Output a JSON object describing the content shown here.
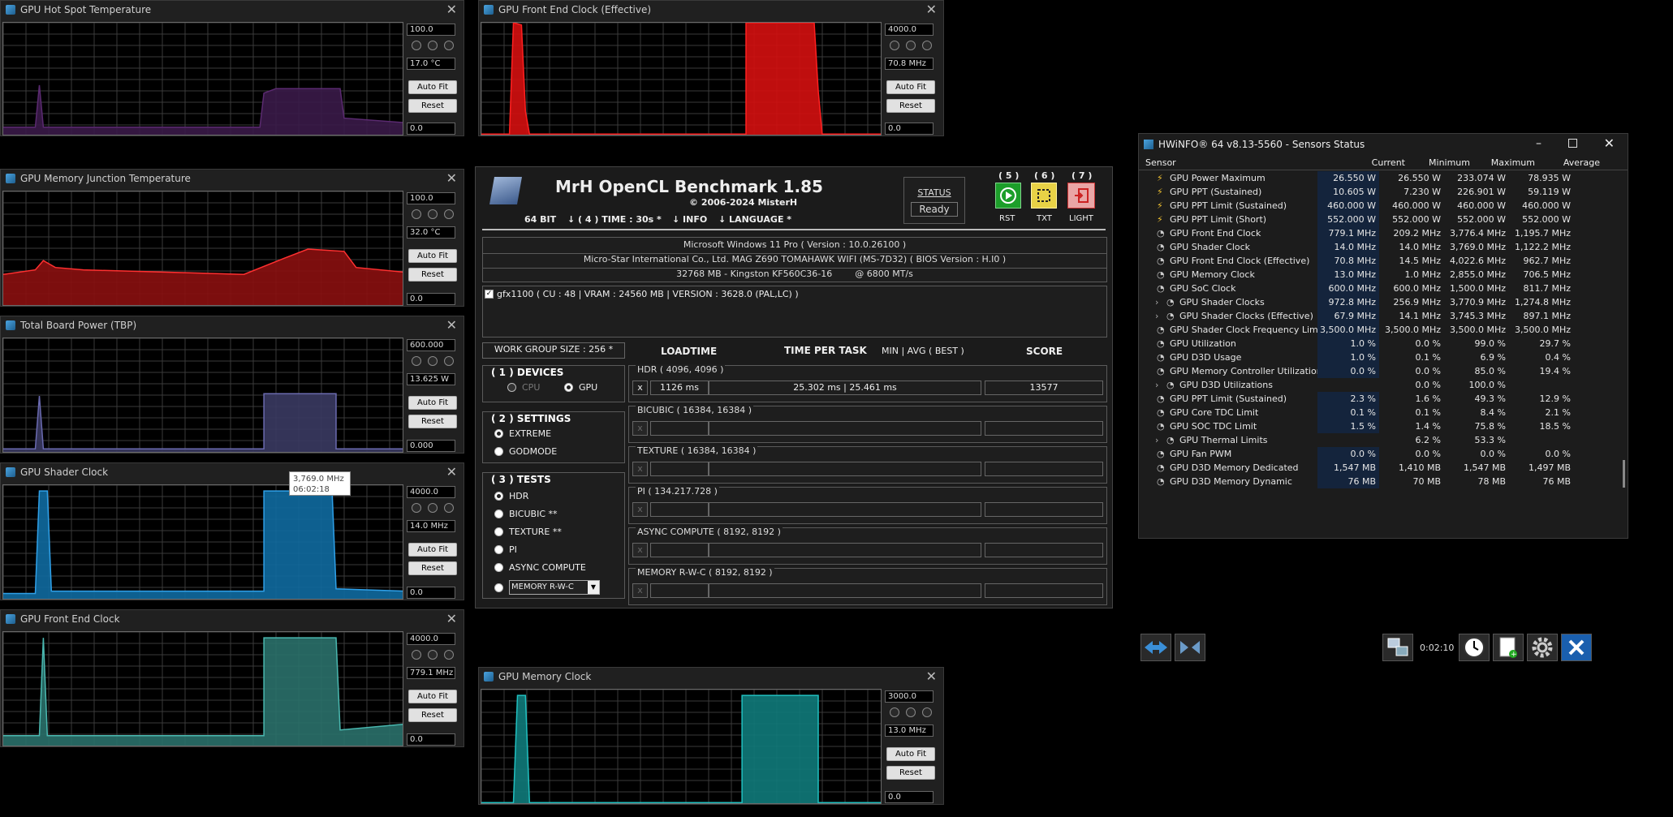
{
  "graph_windows": [
    {
      "id": "hotspot",
      "title": "GPU Hot Spot Temperature",
      "max": "100.0",
      "current": "17.0 °C",
      "min": "0.0",
      "color": "#5a2a70",
      "fill": "#3a1a48"
    },
    {
      "id": "fe-eff",
      "title": "GPU Front End Clock (Effective)",
      "max": "4000.0",
      "current": "70.8 MHz",
      "min": "0.0",
      "color": "#ff2020",
      "fill": "#d41010"
    },
    {
      "id": "memjunc",
      "title": "GPU Memory Junction Temperature",
      "max": "100.0",
      "current": "32.0 °C",
      "min": "0.0",
      "color": "#ff3030",
      "fill": "#8a1010"
    },
    {
      "id": "tbp",
      "title": "Total Board Power (TBP)",
      "max": "600.000",
      "current": "13.625 W",
      "min": "0.000",
      "color": "#6a6ab0",
      "fill": "#3a3a62"
    },
    {
      "id": "shader",
      "title": "GPU Shader Clock",
      "max": "4000.0",
      "current": "14.0 MHz",
      "min": "0.0",
      "color": "#2fa0e8",
      "fill": "#0f6aa0"
    },
    {
      "id": "frontend",
      "title": "GPU Front End Clock",
      "max": "4000.0",
      "current": "779.1 MHz",
      "min": "0.0",
      "color": "#4ab8b0",
      "fill": "#2a706a"
    },
    {
      "id": "memclk",
      "title": "GPU Memory Clock",
      "max": "3000.0",
      "current": "13.0 MHz",
      "min": "0.0",
      "color": "#20c0c0",
      "fill": "#107a7a"
    }
  ],
  "buttons": {
    "autofit": "Auto Fit",
    "reset": "Reset"
  },
  "tooltip": {
    "value": "3,769.0 MHz",
    "time": "06:02:18"
  },
  "mrh": {
    "title": "MrH OpenCL Benchmark 1.85",
    "copyright": "© 2006-2024 MisterH",
    "bits": "64 BIT",
    "time": "↓ ( 4 ) TIME : 30s *",
    "info": "↓ INFO",
    "language": "↓ LANGUAGE *",
    "status_label": "STATUS",
    "status_value": "Ready",
    "top_btns": [
      {
        "n": "( 5 )",
        "l": "RST"
      },
      {
        "n": "( 6 )",
        "l": "TXT"
      },
      {
        "n": "( 7 )",
        "l": "LIGHT"
      }
    ],
    "os": "Microsoft Windows 11 Pro ( Version : 10.0.26100 )",
    "board": "Micro-Star International Co., Ltd. MAG Z690 TOMAHAWK WIFI (MS-7D32) ( BIOS Version : H.I0 )",
    "memory": "32768 MB - Kingston KF560C36-16        @ 6800 MT/s",
    "gpu": "gfx1100 ( CU : 48 | VRAM : 24560 MB | VERSION : 3628.0 (PAL,LC) )",
    "wgs": "WORK GROUP SIZE : 256 *",
    "h_load": "LOADTIME",
    "h_tpt": "TIME PER TASK",
    "h_mab": "MIN | AVG ( BEST )",
    "h_score": "SCORE",
    "devices_title": "( 1 ) DEVICES",
    "cpu": "CPU",
    "gpu_opt": "GPU",
    "settings_title": "( 2 ) SETTINGS",
    "extreme": "EXTREME",
    "godmode": "GODMODE",
    "tests_title": "( 3 ) TESTS",
    "tests": [
      "HDR",
      "BICUBIC **",
      "TEXTURE **",
      "PI",
      "ASYNC COMPUTE"
    ],
    "memory_test": "MEMORY R-W-C",
    "results": [
      {
        "name": "HDR ( 4096, 4096 )",
        "x": "x",
        "load": "1126 ms",
        "tpt": "25.302 ms | 25.461 ms",
        "score": "13577"
      },
      {
        "name": "BICUBIC ( 16384, 16384 )",
        "x": "x",
        "load": "",
        "tpt": "",
        "score": ""
      },
      {
        "name": "TEXTURE ( 16384, 16384 )",
        "x": "x",
        "load": "",
        "tpt": "",
        "score": ""
      },
      {
        "name": "PI ( 134.217.728 )",
        "x": "x",
        "load": "",
        "tpt": "",
        "score": ""
      },
      {
        "name": "ASYNC COMPUTE ( 8192, 8192 )",
        "x": "x",
        "load": "",
        "tpt": "",
        "score": ""
      },
      {
        "name": "MEMORY R-W-C ( 8192, 8192 )",
        "x": "x",
        "load": "",
        "tpt": "",
        "score": ""
      }
    ]
  },
  "hwinfo": {
    "title": "HWiNFO® 64 v8.13-5560 - Sensors Status",
    "cols": [
      "Sensor",
      "Current",
      "Minimum",
      "Maximum",
      "Average"
    ],
    "rows": [
      {
        "i": "bolt",
        "n": "GPU Power Maximum",
        "c": "26.550 W",
        "mi": "26.550 W",
        "ma": "233.074 W",
        "a": "78.935 W",
        "ind": 0
      },
      {
        "i": "bolt",
        "n": "GPU PPT (Sustained)",
        "c": "10.605 W",
        "mi": "7.230 W",
        "ma": "226.901 W",
        "a": "59.119 W",
        "ind": 0
      },
      {
        "i": "bolt",
        "n": "GPU PPT Limit (Sustained)",
        "c": "460.000 W",
        "mi": "460.000 W",
        "ma": "460.000 W",
        "a": "460.000 W",
        "ind": 0
      },
      {
        "i": "bolt",
        "n": "GPU PPT Limit (Short)",
        "c": "552.000 W",
        "mi": "552.000 W",
        "ma": "552.000 W",
        "a": "552.000 W",
        "ind": 0
      },
      {
        "i": "clk",
        "n": "GPU Front End Clock",
        "c": "779.1 MHz",
        "mi": "209.2 MHz",
        "ma": "3,776.4 MHz",
        "a": "1,195.7 MHz",
        "ind": 0
      },
      {
        "i": "clk",
        "n": "GPU Shader Clock",
        "c": "14.0 MHz",
        "mi": "14.0 MHz",
        "ma": "3,769.0 MHz",
        "a": "1,122.2 MHz",
        "ind": 0
      },
      {
        "i": "clk",
        "n": "GPU Front End Clock (Effective)",
        "c": "70.8 MHz",
        "mi": "14.5 MHz",
        "ma": "4,022.6 MHz",
        "a": "962.7 MHz",
        "ind": 0
      },
      {
        "i": "clk",
        "n": "GPU Memory Clock",
        "c": "13.0 MHz",
        "mi": "1.0 MHz",
        "ma": "2,855.0 MHz",
        "a": "706.5 MHz",
        "ind": 0
      },
      {
        "i": "clk",
        "n": "GPU SoC Clock",
        "c": "600.0 MHz",
        "mi": "600.0 MHz",
        "ma": "1,500.0 MHz",
        "a": "811.7 MHz",
        "ind": 0
      },
      {
        "i": "clk",
        "n": "GPU Shader Clocks",
        "c": "972.8 MHz",
        "mi": "256.9 MHz",
        "ma": "3,770.9 MHz",
        "a": "1,274.8 MHz",
        "ind": 1
      },
      {
        "i": "clk",
        "n": "GPU Shader Clocks (Effective)",
        "c": "67.9 MHz",
        "mi": "14.1 MHz",
        "ma": "3,745.3 MHz",
        "a": "897.1 MHz",
        "ind": 1
      },
      {
        "i": "clk",
        "n": "GPU Shader Clock Frequency Limit",
        "c": "3,500.0 MHz",
        "mi": "3,500.0 MHz",
        "ma": "3,500.0 MHz",
        "a": "3,500.0 MHz",
        "ind": 0
      },
      {
        "i": "clk",
        "n": "GPU Utilization",
        "c": "1.0 %",
        "mi": "0.0 %",
        "ma": "99.0 %",
        "a": "29.7 %",
        "ind": 0
      },
      {
        "i": "clk",
        "n": "GPU D3D Usage",
        "c": "1.0 %",
        "mi": "0.1 %",
        "ma": "6.9 %",
        "a": "0.4 %",
        "ind": 0
      },
      {
        "i": "clk",
        "n": "GPU Memory Controller Utilization",
        "c": "0.0 %",
        "mi": "0.0 %",
        "ma": "85.0 %",
        "a": "19.4 %",
        "ind": 0
      },
      {
        "i": "clk",
        "n": "GPU D3D Utilizations",
        "c": "",
        "mi": "0.0 %",
        "ma": "100.0 %",
        "a": "",
        "ind": 1
      },
      {
        "i": "clk",
        "n": "GPU PPT Limit (Sustained)",
        "c": "2.3 %",
        "mi": "1.6 %",
        "ma": "49.3 %",
        "a": "12.9 %",
        "ind": 0
      },
      {
        "i": "clk",
        "n": "GPU Core TDC Limit",
        "c": "0.1 %",
        "mi": "0.1 %",
        "ma": "8.4 %",
        "a": "2.1 %",
        "ind": 0
      },
      {
        "i": "clk",
        "n": "GPU SOC TDC Limit",
        "c": "1.5 %",
        "mi": "1.4 %",
        "ma": "75.8 %",
        "a": "18.5 %",
        "ind": 0
      },
      {
        "i": "clk",
        "n": "GPU Thermal Limits",
        "c": "",
        "mi": "6.2 %",
        "ma": "53.3 %",
        "a": "",
        "ind": 1
      },
      {
        "i": "clk",
        "n": "GPU Fan PWM",
        "c": "0.0 %",
        "mi": "0.0 %",
        "ma": "0.0 %",
        "a": "0.0 %",
        "ind": 0
      },
      {
        "i": "clk",
        "n": "GPU D3D Memory Dedicated",
        "c": "1,547 MB",
        "mi": "1,410 MB",
        "ma": "1,547 MB",
        "a": "1,497 MB",
        "ind": 0
      },
      {
        "i": "clk",
        "n": "GPU D3D Memory Dynamic",
        "c": "76 MB",
        "mi": "70 MB",
        "ma": "78 MB",
        "a": "76 MB",
        "ind": 0
      }
    ],
    "timer": "0:02:10"
  }
}
